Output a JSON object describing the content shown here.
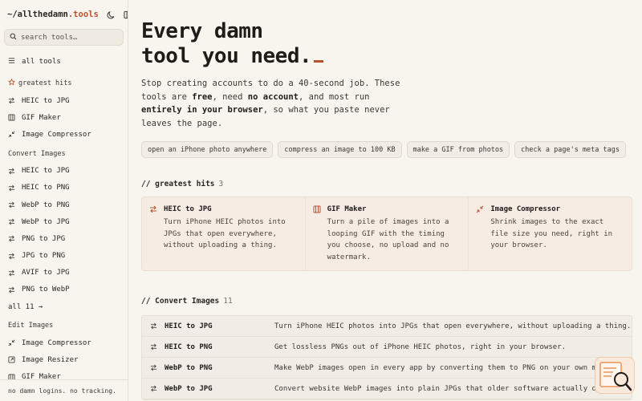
{
  "sidebar": {
    "logo_prefix": "~/allthedamn",
    "logo_suffix": ".tools",
    "search_placeholder": "search tools…",
    "all_tools_label": "all tools",
    "sections": [
      {
        "title": "greatest hits",
        "items": [
          {
            "label": "HEIC to JPG",
            "icon": "arrows-swap-icon"
          },
          {
            "label": "GIF Maker",
            "icon": "film-icon"
          },
          {
            "label": "Image Compressor",
            "icon": "compress-icon"
          }
        ]
      },
      {
        "title": "Convert Images",
        "items": [
          {
            "label": "HEIC to JPG",
            "icon": "arrows-swap-icon"
          },
          {
            "label": "HEIC to PNG",
            "icon": "arrows-swap-icon"
          },
          {
            "label": "WebP to PNG",
            "icon": "arrows-swap-icon"
          },
          {
            "label": "WebP to JPG",
            "icon": "arrows-swap-icon"
          },
          {
            "label": "PNG to JPG",
            "icon": "arrows-swap-icon"
          },
          {
            "label": "JPG to PNG",
            "icon": "arrows-swap-icon"
          },
          {
            "label": "AVIF to JPG",
            "icon": "arrows-swap-icon"
          },
          {
            "label": "PNG to WebP",
            "icon": "arrows-swap-icon"
          }
        ],
        "all_link": "all 11 →"
      },
      {
        "title": "Edit Images",
        "items": [
          {
            "label": "Image Compressor",
            "icon": "compress-icon"
          },
          {
            "label": "Image Resizer",
            "icon": "resize-icon"
          },
          {
            "label": "GIF Maker",
            "icon": "film-icon"
          }
        ]
      }
    ],
    "footer": "no damn logins. no tracking."
  },
  "hero": {
    "title_line1": "Every damn",
    "title_line2": "tool you need.",
    "intro_1": "Stop creating accounts to do a 40-second job. These tools are ",
    "intro_free": "free",
    "intro_2": ", need ",
    "intro_no_account": "no account",
    "intro_3": ", and most run ",
    "intro_browser": "entirely in your browser",
    "intro_4": ", so what you paste never leaves the page."
  },
  "chips": [
    "open an iPhone photo anywhere",
    "compress an image to 100 KB",
    "make a GIF from photos",
    "check a page's meta tags"
  ],
  "greatest_hits": {
    "title": "// greatest hits",
    "count": "3",
    "cards": [
      {
        "name": "HEIC to JPG",
        "icon": "arrows-swap-icon",
        "desc": "Turn iPhone HEIC photos into JPGs that open everywhere, without uploading a thing."
      },
      {
        "name": "GIF Maker",
        "icon": "film-icon",
        "desc": "Turn a pile of images into a looping GIF with the timing you choose, no upload and no watermark."
      },
      {
        "name": "Image Compressor",
        "icon": "compress-icon",
        "desc": "Shrink images to the exact file size you need, right in your browser."
      }
    ]
  },
  "convert_images": {
    "title": "// Convert Images",
    "count": "11",
    "rows": [
      {
        "name": "HEIC to JPG",
        "desc": "Turn iPhone HEIC photos into JPGs that open everywhere, without uploading a thing."
      },
      {
        "name": "HEIC to PNG",
        "desc": "Get lossless PNGs out of iPhone HEIC photos, right in your browser."
      },
      {
        "name": "WebP to PNG",
        "desc": "Make WebP images open in every app by converting them to PNG on your own machine."
      },
      {
        "name": "WebP to JPG",
        "desc": "Convert website WebP images into plain JPGs that older software actually opens."
      }
    ]
  },
  "colors": {
    "accent": "#b5532f",
    "background": "#f8f5ef",
    "card_bg": "#f6ece3"
  }
}
